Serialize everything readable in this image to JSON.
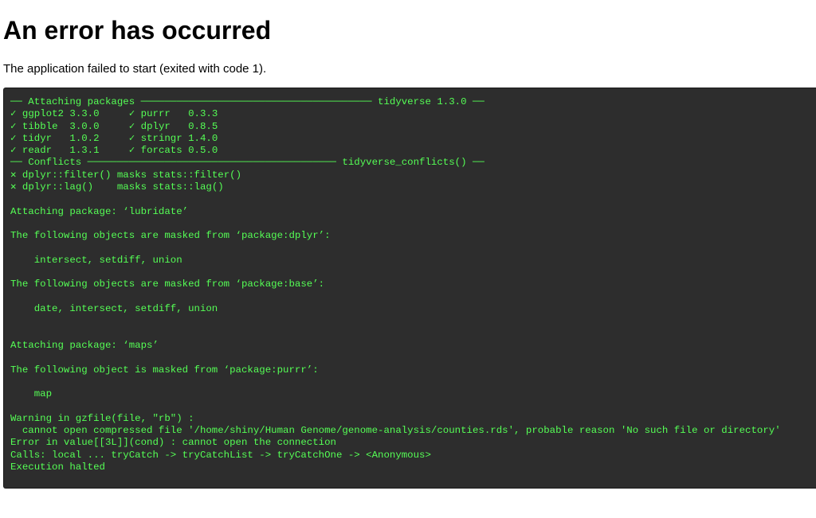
{
  "page": {
    "title": "An error has occurred",
    "description": "The application failed to start (exited with code 1)."
  },
  "console": {
    "lines": [
      "── Attaching packages ─────────────────────────────────────── tidyverse 1.3.0 ──",
      "✓ ggplot2 3.3.0     ✓ purrr   0.3.3",
      "✓ tibble  3.0.0     ✓ dplyr   0.8.5",
      "✓ tidyr   1.0.2     ✓ stringr 1.4.0",
      "✓ readr   1.3.1     ✓ forcats 0.5.0",
      "── Conflicts ────────────────────────────────────────── tidyverse_conflicts() ──",
      "✕ dplyr::filter() masks stats::filter()",
      "✕ dplyr::lag()    masks stats::lag()",
      "",
      "Attaching package: ‘lubridate’",
      "",
      "The following objects are masked from ‘package:dplyr’:",
      "",
      "    intersect, setdiff, union",
      "",
      "The following objects are masked from ‘package:base’:",
      "",
      "    date, intersect, setdiff, union",
      "",
      "",
      "Attaching package: ‘maps’",
      "",
      "The following object is masked from ‘package:purrr’:",
      "",
      "    map",
      "",
      "Warning in gzfile(file, \"rb\") :",
      "  cannot open compressed file '/home/shiny/Human Genome/genome-analysis/counties.rds', probable reason 'No such file or directory'",
      "Error in value[[3L]](cond) : cannot open the connection",
      "Calls: local ... tryCatch -> tryCatchList -> tryCatchOne -> <Anonymous>",
      "Execution halted"
    ]
  },
  "colors": {
    "console_background": "#2d2d2d",
    "console_text": "#55ff55"
  }
}
